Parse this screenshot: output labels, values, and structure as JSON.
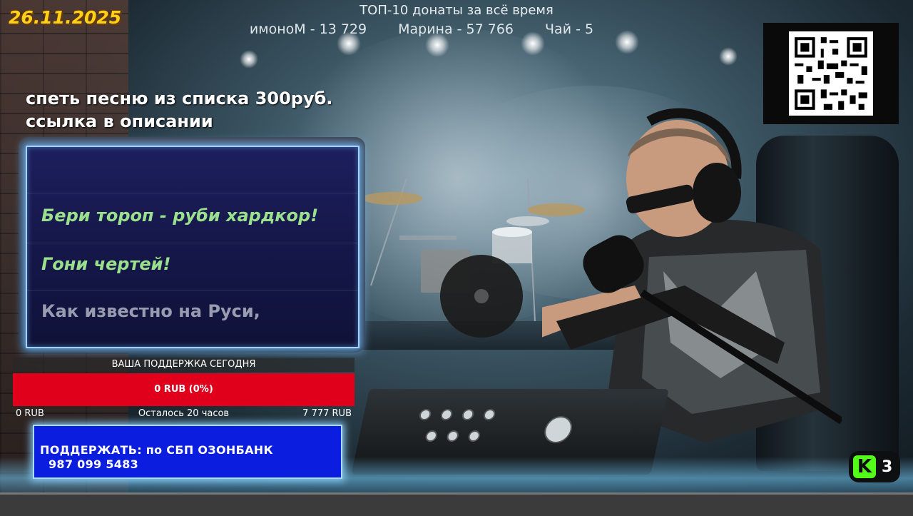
{
  "overlay": {
    "date": "26.11.2025",
    "top_donations": {
      "title": "ТОП-10 донаты за всё время",
      "entries": [
        "имоноМ - 13 729",
        "Марина - 57 766",
        "Чай - 5"
      ]
    },
    "song_info": {
      "line1": "спеть песню из списка 300руб.",
      "line2": "ссылка в описании"
    }
  },
  "lyrics": {
    "lines": [
      "Бери тороп - руби хардкор!",
      "Гони чертей!",
      "Как известно на Руси,"
    ]
  },
  "support": {
    "label": "ВАША ПОДДЕРЖКА СЕГОДНЯ",
    "progress_text": "0 RUB (0%)",
    "progress_fraction": 0,
    "min": "0 RUB",
    "remaining": "Осталось 20 часов",
    "goal": "7 777 RUB"
  },
  "donate": {
    "line1": "ПОДДЕРЖАТЬ: по СБП ОЗОНБАНК",
    "line2": "987 099 5483"
  },
  "kick": {
    "logo": "K",
    "viewers": "3"
  },
  "icons": {
    "qr": "qr-code-icon",
    "kick": "kick-logo-icon"
  },
  "colors": {
    "date": "#ffd21a",
    "lyrics_active": "#9be08c",
    "progress": "#e0001b",
    "donate_bg": "#0b1ee0",
    "kick_green": "#53fc18"
  }
}
